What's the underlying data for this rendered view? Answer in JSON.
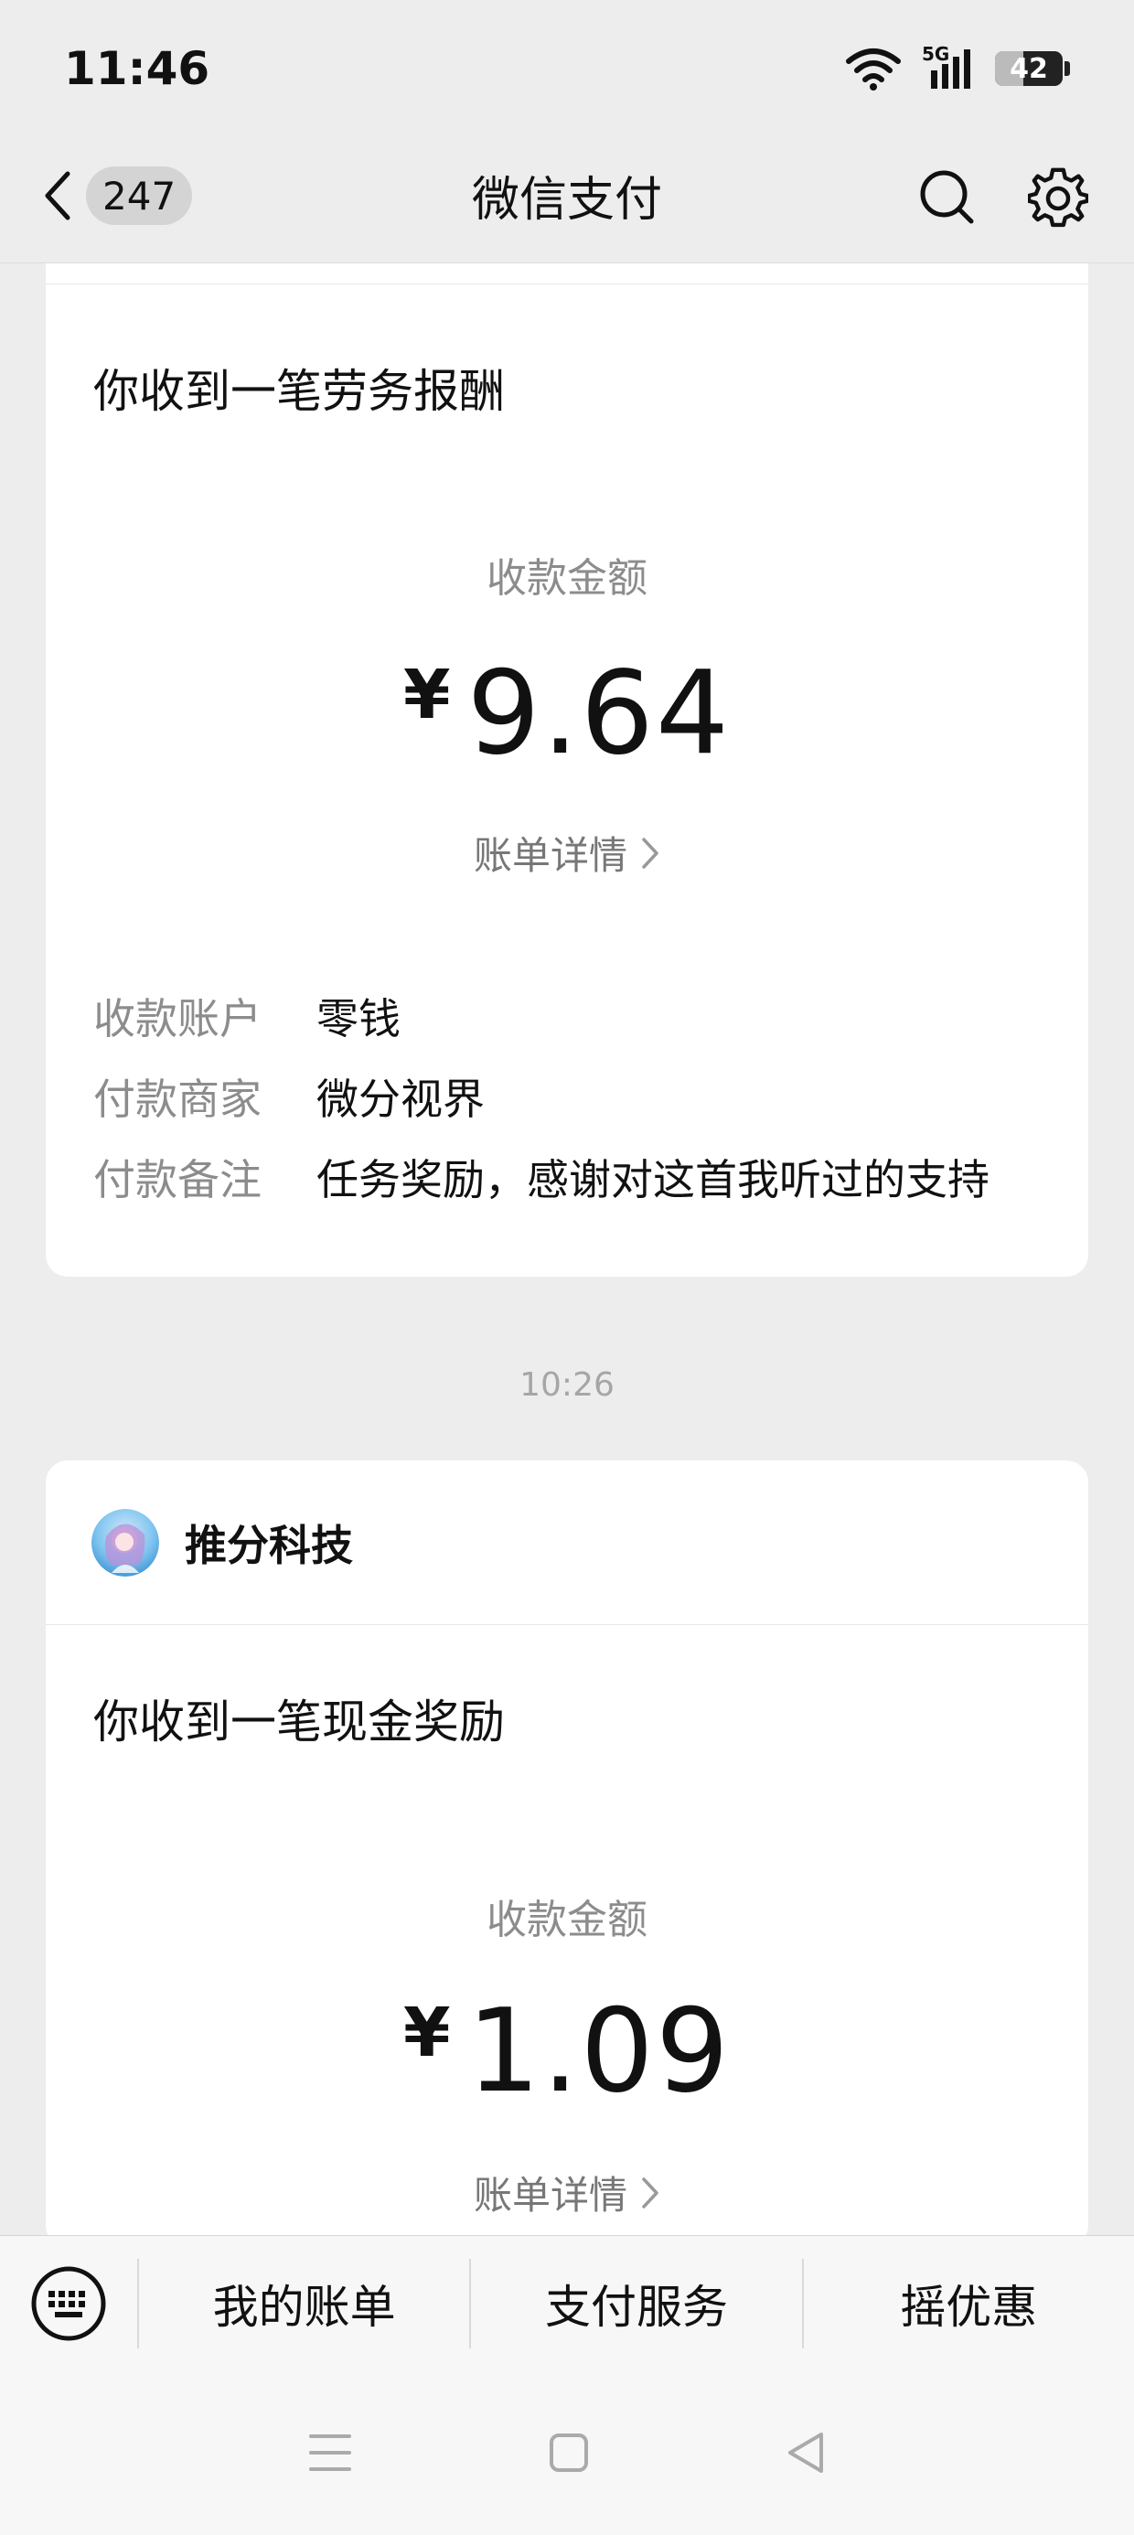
{
  "status_bar": {
    "time": "11:46",
    "network": "5G",
    "battery": "42"
  },
  "nav": {
    "unread_count": "247",
    "title": "微信支付"
  },
  "card1": {
    "title": "你收到一笔劳务报酬",
    "amount_label": "收款金额",
    "currency": "¥",
    "amount": "9.64",
    "detail_link": "账单详情",
    "rows": [
      {
        "key": "收款账户",
        "value": "零钱"
      },
      {
        "key": "付款商家",
        "value": "微分视界"
      },
      {
        "key": "付款备注",
        "value": "任务奖励，感谢对这首我听过的支持"
      }
    ]
  },
  "timestamp": "10:26",
  "card2": {
    "merchant": "推分科技",
    "title": "你收到一笔现金奖励",
    "amount_label": "收款金额",
    "currency": "¥",
    "amount": "1.09",
    "detail_link": "账单详情"
  },
  "bottom_menu": {
    "items": [
      "我的账单",
      "支付服务",
      "摇优惠"
    ]
  },
  "colors": {
    "page_bg": "#ededed",
    "card_bg": "#ffffff",
    "muted_text": "#8c8c8c",
    "text": "#111111"
  }
}
